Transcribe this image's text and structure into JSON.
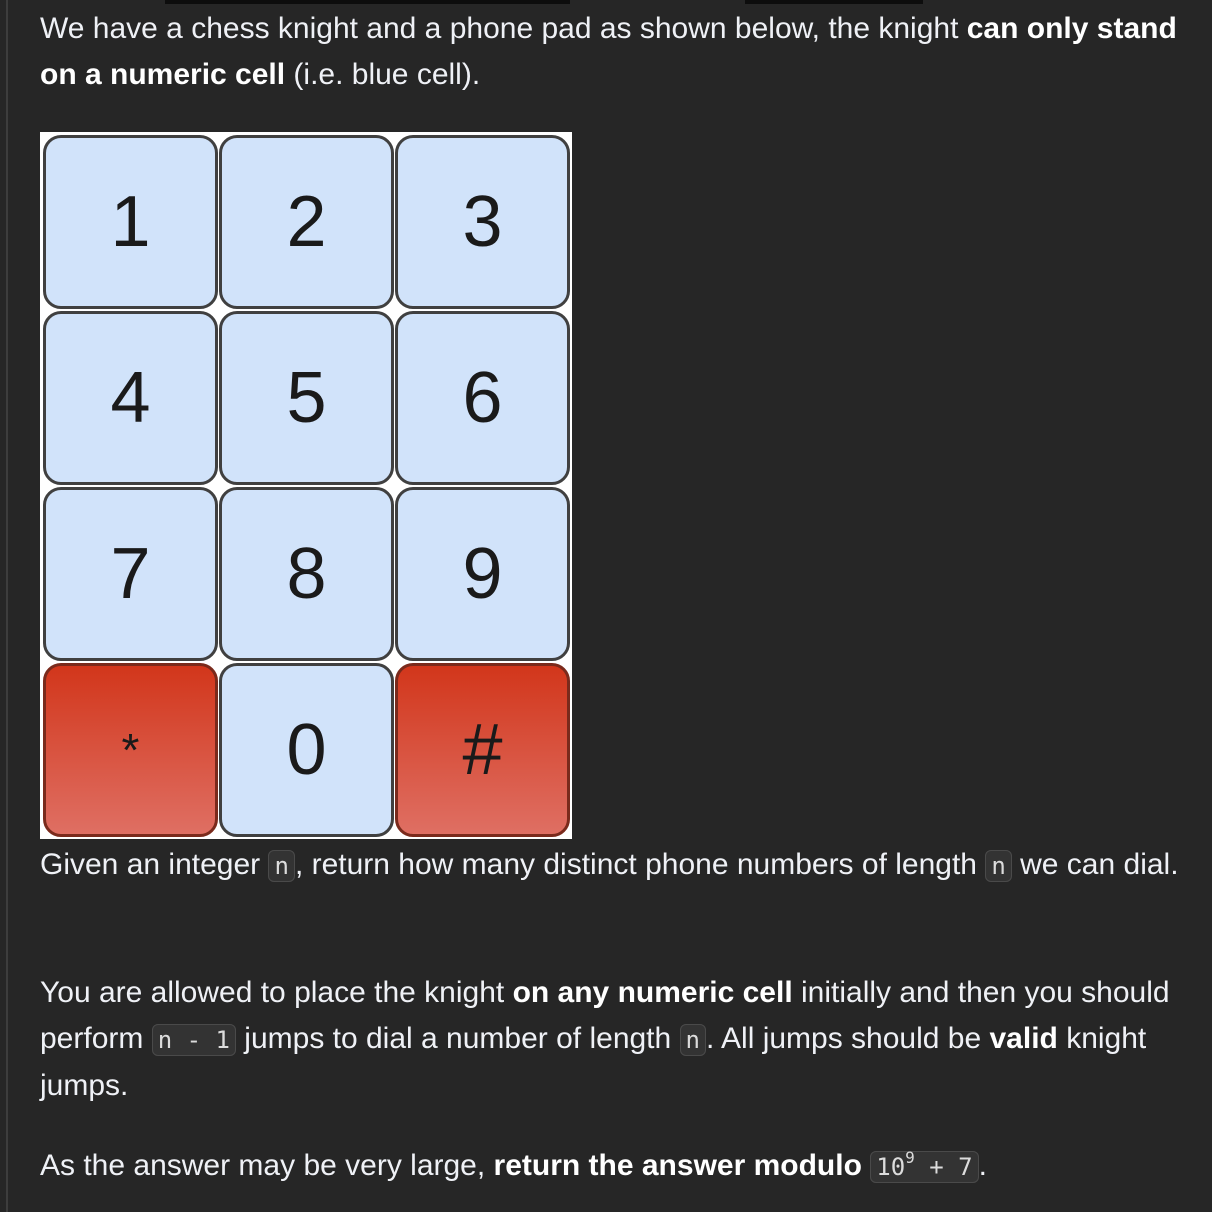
{
  "intro": {
    "t1": "We have a chess knight and a phone pad as shown below, the knight ",
    "b1": "can only stand on a numeric cell",
    "t2": " (i.e. blue cell)."
  },
  "keypad": {
    "keys": [
      "1",
      "2",
      "3",
      "4",
      "5",
      "6",
      "7",
      "8",
      "9",
      "*",
      "0",
      "#"
    ],
    "colors": {
      "numeric": "#d1e3fa",
      "invalid": "#d2361b",
      "border": "#404040"
    }
  },
  "para2": {
    "t1": "Given an integer ",
    "c1": "n",
    "t2": ", return how many distinct phone numbers of length ",
    "c2": "n",
    "t3": " we can dial."
  },
  "para3": {
    "t1": "You are allowed to place the knight ",
    "b1": "on any numeric cell",
    "t2": " initially and then you should perform ",
    "c1": "n - 1",
    "t3": " jumps to dial a number of length ",
    "c2": "n",
    "t4": ". All jumps should be ",
    "b2": "valid",
    "t5": " knight jumps."
  },
  "para4": {
    "t1": "As the answer may be very large, ",
    "b1": "return the answer modulo",
    "c1_base": "10",
    "c1_exp": "9",
    "c1_rest": " + 7",
    "t2": "."
  }
}
